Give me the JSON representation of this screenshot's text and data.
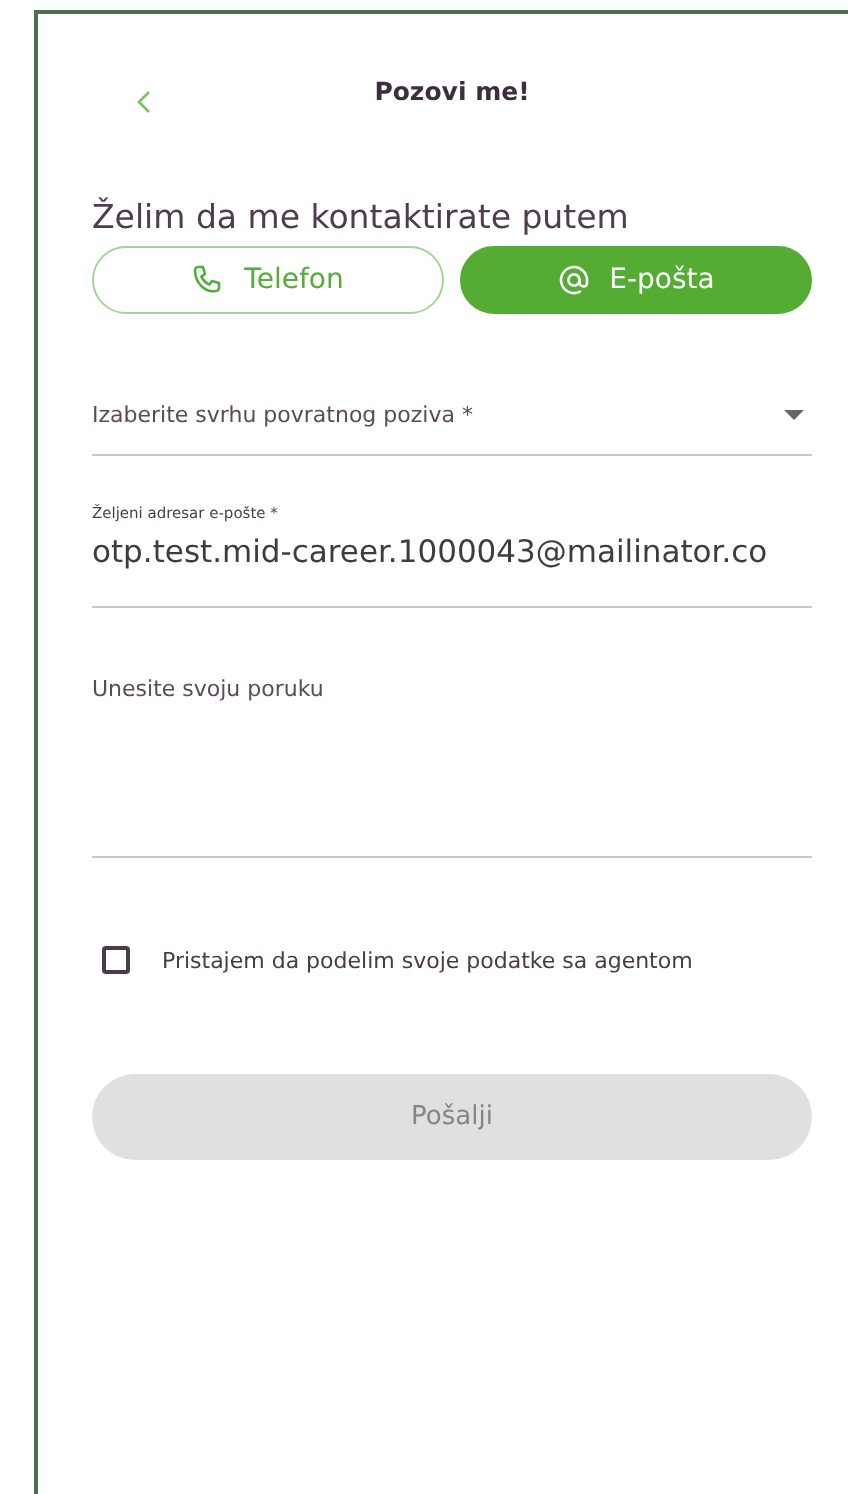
{
  "header": {
    "title": "Pozovi me!"
  },
  "contact": {
    "prompt": "Želim da me kontaktirate putem",
    "methods": [
      {
        "label": "Telefon",
        "kind": "phone",
        "selected": false
      },
      {
        "label": "E-pošta",
        "kind": "email",
        "selected": true
      }
    ]
  },
  "fields": [
    {
      "kind": "select",
      "placeholder": "Izaberite svrhu povratnog poziva *"
    },
    {
      "kind": "input",
      "label": "Željeni adresar e-pošte *",
      "value": "otp.test.mid-career.1000043@mailinator.co"
    },
    {
      "kind": "textarea",
      "placeholder": "Unesite svoju poruku"
    }
  ],
  "consent": {
    "label": "Pristajem da podelim svoje podatke sa agentom",
    "checked": false
  },
  "submit": {
    "label": "Pošalji",
    "disabled": true
  }
}
